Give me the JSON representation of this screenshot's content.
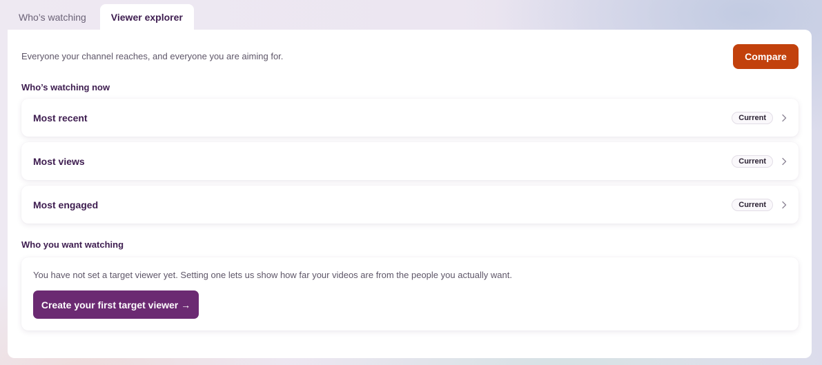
{
  "tabs": [
    {
      "label": "Who’s watching",
      "active": false
    },
    {
      "label": "Viewer explorer",
      "active": true
    }
  ],
  "intro": "Everyone your channel reaches, and everyone you are aiming for.",
  "compare_label": "Compare",
  "watching_now": {
    "title": "Who’s watching now",
    "items": [
      {
        "label": "Most recent",
        "badge": "Current",
        "icon": "chevron-right-icon"
      },
      {
        "label": "Most views",
        "badge": "Current",
        "icon": "chevron-right-icon"
      },
      {
        "label": "Most engaged",
        "badge": "Current",
        "icon": "chevron-right-icon"
      }
    ]
  },
  "want_watching": {
    "title": "Who you want watching",
    "empty_text": "You have not set a target viewer yet. Setting one lets us show how far your videos are from the people you actually want.",
    "cta_label": "Create your first target viewer →"
  },
  "colors": {
    "accent_orange": "#c2410c",
    "accent_purple": "#6b2a72",
    "heading": "#3d1c4f"
  }
}
